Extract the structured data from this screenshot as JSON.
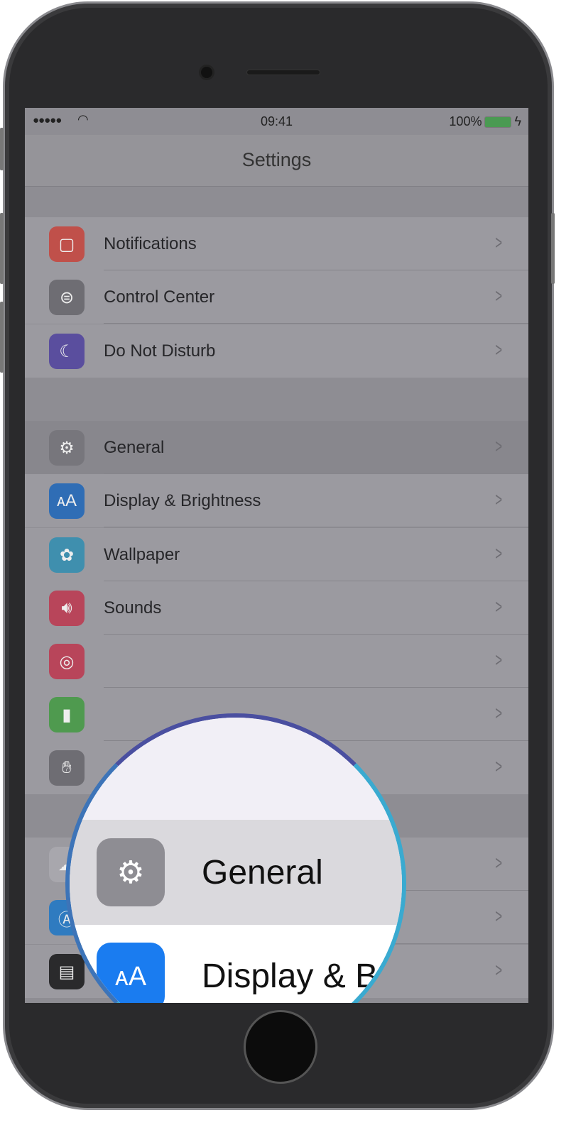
{
  "status_bar": {
    "signal": "●●●●●",
    "time": "09:41",
    "battery": "100%",
    "battery_color": "#4a9a52"
  },
  "nav": {
    "title": "Settings"
  },
  "groups": [
    [
      {
        "label": "Notifications",
        "icon": "notifications-icon",
        "color": "#c0504a"
      },
      {
        "label": "Control Center",
        "icon": "control-center-icon",
        "color": "#6e6d73"
      },
      {
        "label": "Do Not Disturb",
        "icon": "moon-icon",
        "color": "#5a4e9e"
      }
    ],
    [
      {
        "label": "General",
        "icon": "gear-icon",
        "color": "#77767c",
        "highlighted": true
      },
      {
        "label": "Display & Brightness",
        "icon": "text-size-icon",
        "color": "#2f6db5"
      },
      {
        "label": "Wallpaper",
        "icon": "flower-icon",
        "color": "#3f8fae"
      },
      {
        "label": "Sounds",
        "icon": "speaker-icon",
        "color": "#b8455a"
      },
      {
        "label": "",
        "icon": "fingerprint-icon",
        "color": "#b8455a"
      },
      {
        "label": "",
        "icon": "battery-icon",
        "color": "#4f9a4f"
      },
      {
        "label": "",
        "icon": "hand-icon",
        "color": "#6e6d73"
      }
    ],
    [
      {
        "label": "",
        "icon": "cloud-icon",
        "color": "#a8a7ad"
      },
      {
        "label": "App Store",
        "icon": "app-store-icon",
        "color": "#2f7bc0"
      },
      {
        "label": "Wallet & Apple Pay",
        "icon": "wallet-icon",
        "color": "#2a2a2c"
      }
    ]
  ],
  "magnifier": {
    "general_label": "General",
    "display_label": "Display & B"
  }
}
